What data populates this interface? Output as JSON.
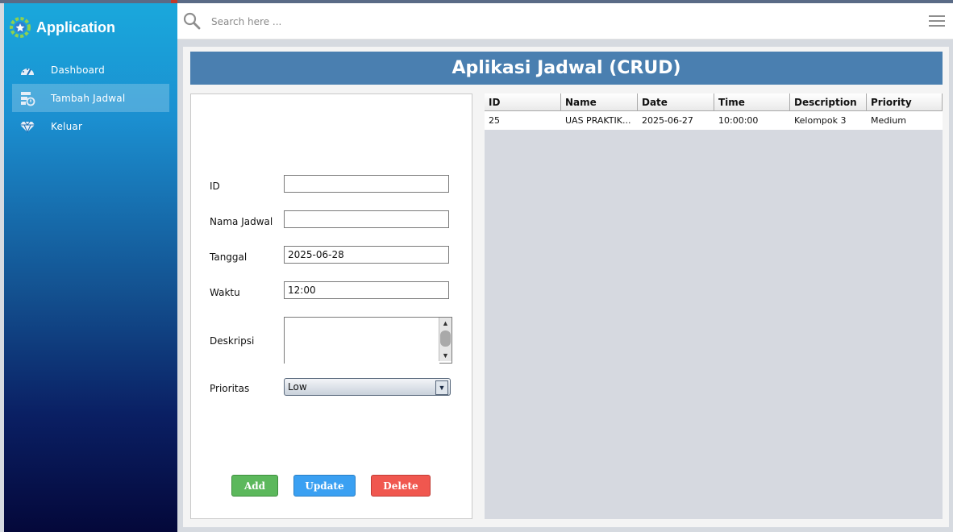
{
  "sidebar": {
    "title": "Application",
    "items": [
      {
        "label": "Dashboard",
        "icon": "gauge-icon"
      },
      {
        "label": "Tambah Jadwal",
        "icon": "schedule-add-icon",
        "active": true
      },
      {
        "label": "Keluar",
        "icon": "diamond-icon"
      }
    ]
  },
  "topbar": {
    "search_placeholder": "Search here ..."
  },
  "header": {
    "title": "Aplikasi Jadwal (CRUD)"
  },
  "form": {
    "id_label": "ID",
    "id_value": "",
    "name_label": "Nama Jadwal",
    "name_value": "",
    "date_label": "Tanggal",
    "date_value": "2025-06-28",
    "time_label": "Waktu",
    "time_value": "12:00",
    "desc_label": "Deskripsi",
    "desc_value": "",
    "priority_label": "Prioritas",
    "priority_value": "Low",
    "add_label": "Add",
    "update_label": "Update",
    "delete_label": "Delete"
  },
  "table": {
    "columns": [
      "ID",
      "Name",
      "Date",
      "Time",
      "Description",
      "Priority"
    ],
    "rows": [
      [
        "25",
        "UAS PRAKTIK...",
        "2025-06-27",
        "10:00:00",
        "Kelompok 3",
        "Medium"
      ]
    ]
  },
  "colors": {
    "header_bar": "#4a7fb0",
    "add_button": "#5cb85c",
    "update_button": "#3aa0f2",
    "delete_button": "#f0574f"
  }
}
